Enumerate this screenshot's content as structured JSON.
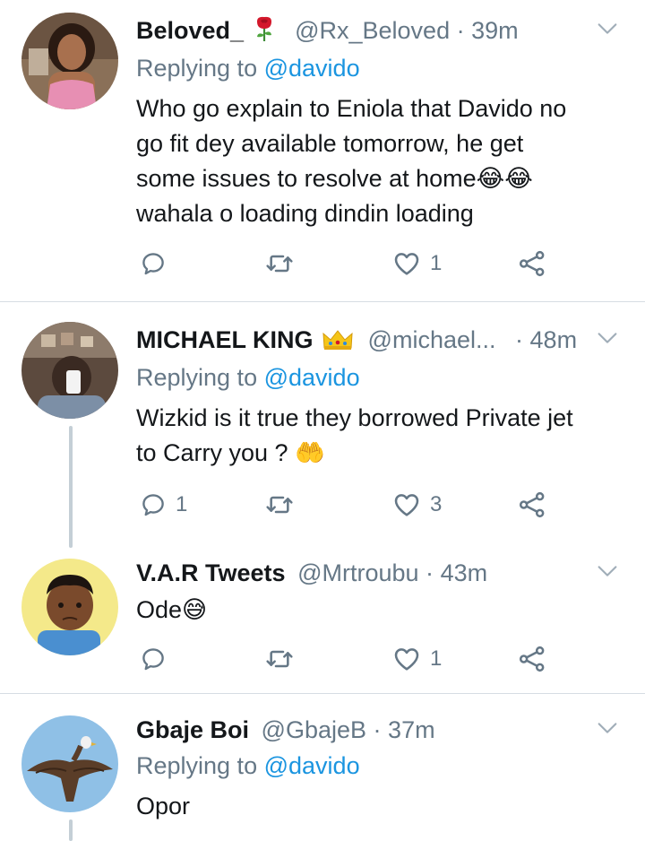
{
  "tweets": [
    {
      "name": "Beloved_",
      "handle": "@Rx_Beloved",
      "time": "39m",
      "replying_prefix": "Replying to",
      "replying_to": "@davido",
      "text_lines": [
        "Who go explain to Eniola that Davido no",
        "go fit dey available tomorrow, he get",
        "some issues to resolve at home😂😂",
        "wahala o loading dindin loading"
      ],
      "name_emoji": "rose",
      "reply_count": "",
      "retweet_count": "",
      "like_count": "1"
    },
    {
      "name": "MICHAEL KING",
      "handle": "@michael...",
      "time": "48m",
      "replying_prefix": "Replying to",
      "replying_to": "@davido",
      "text_lines": [
        "Wizkid is it true they borrowed Private jet",
        "to Carry you ? 🤲"
      ],
      "name_emoji": "crown",
      "reply_count": "1",
      "retweet_count": "",
      "like_count": "3"
    },
    {
      "name": "V.A.R Tweets",
      "handle": "@Mrtroubu",
      "time": "43m",
      "text_lines": [
        "Ode😅"
      ],
      "reply_count": "",
      "retweet_count": "",
      "like_count": "1"
    },
    {
      "name": "Gbaje Boi",
      "handle": "@GbajeB",
      "time": "37m",
      "replying_prefix": "Replying to",
      "replying_to": "@davido",
      "text_lines": [
        "Opor"
      ]
    }
  ],
  "separator": "·",
  "icons": [
    "reply-icon",
    "retweet-icon",
    "like-icon",
    "share-icon",
    "chevron-down-icon"
  ],
  "colors": {
    "secondary_text": "#657786",
    "link": "#1b95e0",
    "divider": "#d6dde3"
  }
}
